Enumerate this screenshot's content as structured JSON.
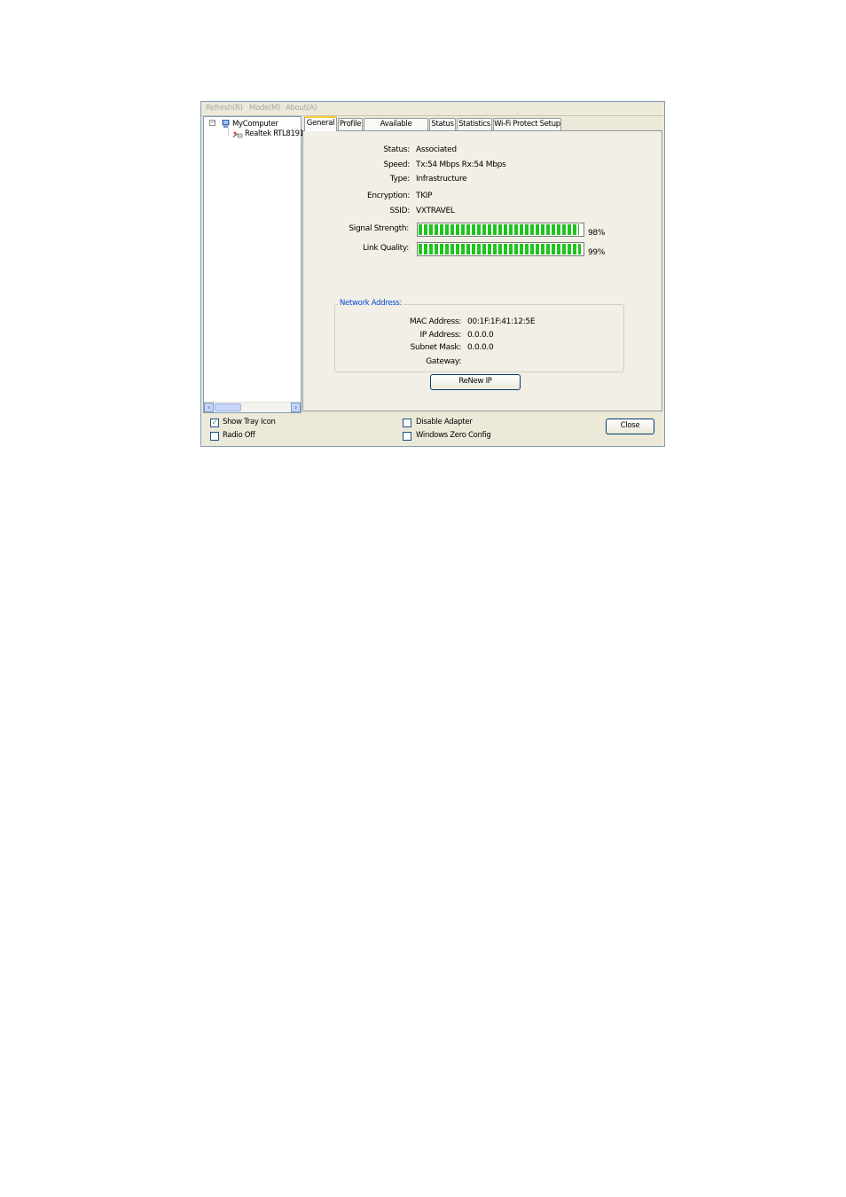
{
  "menu": {
    "items": [
      "Refresh(R)",
      "Mode(M)",
      "About(A)"
    ]
  },
  "tree": {
    "root": "MyComputer",
    "child": "Realtek RTL8191"
  },
  "tabs": [
    "General",
    "Profile",
    "Available Network",
    "Status",
    "Statistics",
    "Wi-Fi Protect Setup"
  ],
  "active_tab": "General",
  "general": {
    "status_label": "Status:",
    "status": "Associated",
    "speed_label": "Speed:",
    "speed": "Tx:54 Mbps Rx:54 Mbps",
    "type_label": "Type:",
    "type": "Infrastructure",
    "encryption_label": "Encryption:",
    "encryption": "TKIP",
    "ssid_label": "SSID:",
    "ssid": "VXTRAVEL",
    "signal_label": "Signal Strength:",
    "signal_text": "98%",
    "signal_value": 98,
    "link_label": "Link Quality:",
    "link_text": "99%",
    "link_value": 99
  },
  "network": {
    "title": "Network Address:",
    "mac_label": "MAC Address:",
    "mac": "00:1F:1F:41:12:5E",
    "ip_label": "IP Address:",
    "ip": "0.0.0.0",
    "mask_label": "Subnet Mask:",
    "mask": "0.0.0.0",
    "gateway_label": "Gateway:",
    "gateway": ""
  },
  "renew_label": "ReNew IP",
  "bottom": {
    "show_tray": {
      "label": "Show Tray Icon",
      "checked": true
    },
    "radio_off": {
      "label": "Radio Off",
      "checked": false
    },
    "disable_adapter": {
      "label": "Disable Adapter",
      "checked": false
    },
    "wzc": {
      "label": "Windows Zero Config",
      "checked": false
    },
    "close_label": "Close"
  },
  "colors": {
    "signal_fill": "#1fc41f",
    "group_title": "#0046d5",
    "tab_highlight": "#ffc83c"
  }
}
